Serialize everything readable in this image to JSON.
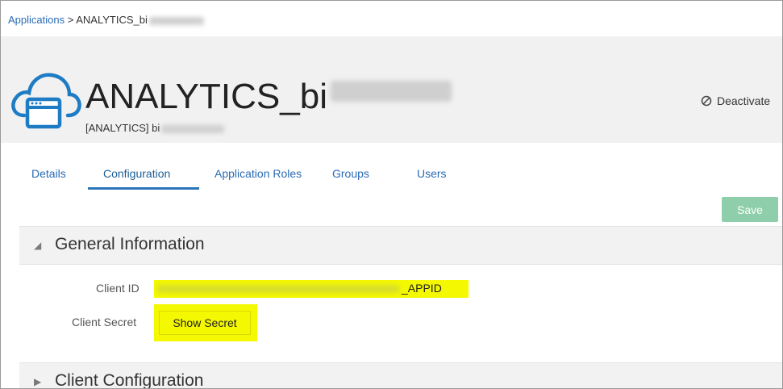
{
  "breadcrumb": {
    "parent": "Applications",
    "separator": ">",
    "current": "ANALYTICS_bi"
  },
  "header": {
    "title": "ANALYTICS_bi",
    "subtitle": "[ANALYTICS] bi",
    "deactivate_label": "Deactivate"
  },
  "tabs": [
    {
      "label": "Details"
    },
    {
      "label": "Configuration"
    },
    {
      "label": "Application Roles"
    },
    {
      "label": "Groups"
    },
    {
      "label": "Users"
    }
  ],
  "active_tab": "Configuration",
  "toolbar": {
    "save_label": "Save"
  },
  "general_section": {
    "title": "General Information",
    "client_id_label": "Client ID",
    "client_id_suffix": "_APPID",
    "client_secret_label": "Client Secret",
    "show_secret_label": "Show Secret"
  },
  "client_config_section": {
    "title": "Client Configuration"
  },
  "colors": {
    "link": "#2a6bb3",
    "accent_blue": "#2a75b8",
    "save_disabled": "#8fceaa",
    "highlight": "#f4f800",
    "header_bg": "#f1f1f1"
  },
  "icons": {
    "app": "cloud-window-icon",
    "deactivate": "prohibited-circle-icon",
    "expanded": "triangle-down-icon",
    "collapsed": "triangle-right-icon"
  }
}
